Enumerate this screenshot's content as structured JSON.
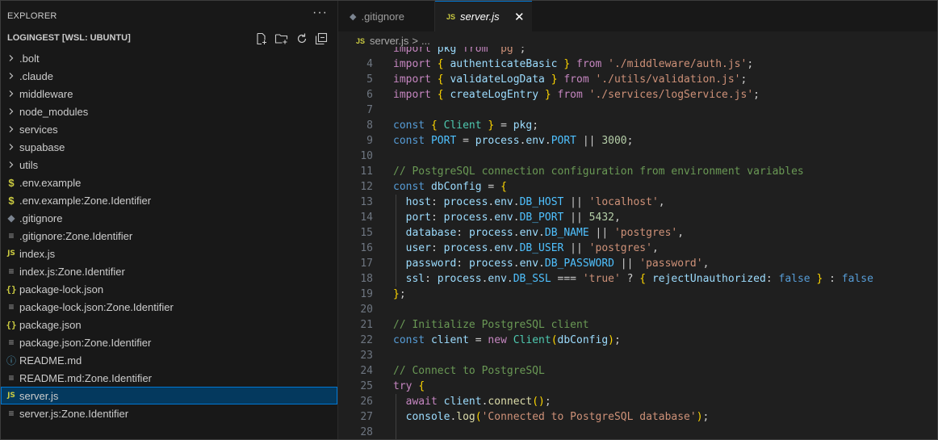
{
  "explorer": {
    "title": "EXPLORER",
    "more_label": "···",
    "project": "LOGINGEST [WSL: UBUNTU]",
    "items": [
      {
        "label": ".bolt",
        "icon": "chevron-right-icon"
      },
      {
        "label": ".claude",
        "icon": "chevron-right-icon"
      },
      {
        "label": "middleware",
        "icon": "chevron-right-icon"
      },
      {
        "label": "node_modules",
        "icon": "chevron-right-icon"
      },
      {
        "label": "services",
        "icon": "chevron-right-icon"
      },
      {
        "label": "supabase",
        "icon": "chevron-right-icon"
      },
      {
        "label": "utils",
        "icon": "chevron-right-icon"
      },
      {
        "label": ".env.example",
        "icon": "dollar-icon"
      },
      {
        "label": ".env.example:Zone.Identifier",
        "icon": "dollar-icon"
      },
      {
        "label": ".gitignore",
        "icon": "git-icon"
      },
      {
        "label": ".gitignore:Zone.Identifier",
        "icon": "lines-icon"
      },
      {
        "label": "index.js",
        "icon": "js-icon"
      },
      {
        "label": "index.js:Zone.Identifier",
        "icon": "lines-icon"
      },
      {
        "label": "package-lock.json",
        "icon": "json-icon"
      },
      {
        "label": "package-lock.json:Zone.Identifier",
        "icon": "lines-icon"
      },
      {
        "label": "package.json",
        "icon": "json-icon"
      },
      {
        "label": "package.json:Zone.Identifier",
        "icon": "lines-icon"
      },
      {
        "label": "README.md",
        "icon": "info-icon"
      },
      {
        "label": "README.md:Zone.Identifier",
        "icon": "lines-icon"
      },
      {
        "label": "server.js",
        "icon": "js-icon",
        "selected": true
      },
      {
        "label": "server.js:Zone.Identifier",
        "icon": "lines-icon"
      }
    ]
  },
  "tabs": [
    {
      "label": ".gitignore",
      "icon": "git-icon",
      "active": false
    },
    {
      "label": "server.js",
      "icon": "js-icon",
      "active": true,
      "close": "✕"
    }
  ],
  "breadcrumb": {
    "file": "server.js",
    "separator": ">",
    "rest": "..."
  },
  "code": [
    {
      "n": "",
      "t": "import pkg from 'pg';"
    },
    {
      "n": "4",
      "t": "import { authenticateBasic } from './middleware/auth.js';"
    },
    {
      "n": "5",
      "t": "import { validateLogData } from './utils/validation.js';"
    },
    {
      "n": "6",
      "t": "import { createLogEntry } from './services/logService.js';"
    },
    {
      "n": "7",
      "t": ""
    },
    {
      "n": "8",
      "t": "const { Client } = pkg;"
    },
    {
      "n": "9",
      "t": "const PORT = process.env.PORT || 3000;"
    },
    {
      "n": "10",
      "t": ""
    },
    {
      "n": "11",
      "t": "// PostgreSQL connection configuration from environment variables"
    },
    {
      "n": "12",
      "t": "const dbConfig = {"
    },
    {
      "n": "13",
      "t": "  host: process.env.DB_HOST || 'localhost',"
    },
    {
      "n": "14",
      "t": "  port: process.env.DB_PORT || 5432,"
    },
    {
      "n": "15",
      "t": "  database: process.env.DB_NAME || 'postgres',"
    },
    {
      "n": "16",
      "t": "  user: process.env.DB_USER || 'postgres',"
    },
    {
      "n": "17",
      "t": "  password: process.env.DB_PASSWORD || 'password',"
    },
    {
      "n": "18",
      "t": "  ssl: process.env.DB_SSL === 'true' ? { rejectUnauthorized: false } : false"
    },
    {
      "n": "19",
      "t": "};"
    },
    {
      "n": "20",
      "t": ""
    },
    {
      "n": "21",
      "t": "// Initialize PostgreSQL client"
    },
    {
      "n": "22",
      "t": "const client = new Client(dbConfig);"
    },
    {
      "n": "23",
      "t": ""
    },
    {
      "n": "24",
      "t": "// Connect to PostgreSQL"
    },
    {
      "n": "25",
      "t": "try {"
    },
    {
      "n": "26",
      "t": "  await client.connect();"
    },
    {
      "n": "27",
      "t": "  console.log('Connected to PostgreSQL database');"
    },
    {
      "n": "28",
      "t": ""
    }
  ],
  "colors": {
    "accent": "#0078d4",
    "selection": "#04395e",
    "sidebar_bg": "#181818",
    "editor_bg": "#1f1f1f"
  }
}
